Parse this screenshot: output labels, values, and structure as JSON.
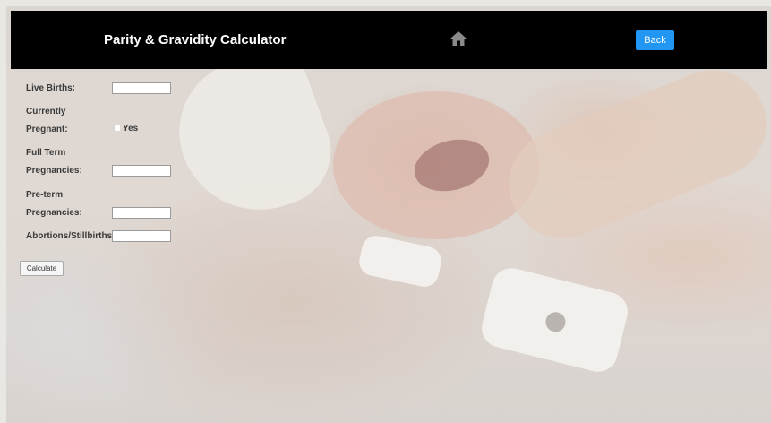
{
  "header": {
    "title": "Parity & Gravidity Calculator",
    "home_icon": "home-icon",
    "back_label": "Back",
    "back_color": "#2196f3"
  },
  "form": {
    "live_births_label": "Live Births:",
    "live_births_value": "",
    "currently_pregnant_label_line1": "Currently",
    "currently_pregnant_label_line2": "Pregnant:",
    "currently_pregnant_option": "Yes",
    "currently_pregnant_checked": false,
    "full_term_label_line1": "Full Term",
    "full_term_label_line2": "Pregnancies:",
    "full_term_value": "",
    "preterm_label_line1": "Pre-term",
    "preterm_label_line2": "Pregnancies:",
    "preterm_value": "",
    "abortions_label": "Abortions/Stillbirths",
    "abortions_value": "",
    "calculate_label": "Calculate"
  }
}
